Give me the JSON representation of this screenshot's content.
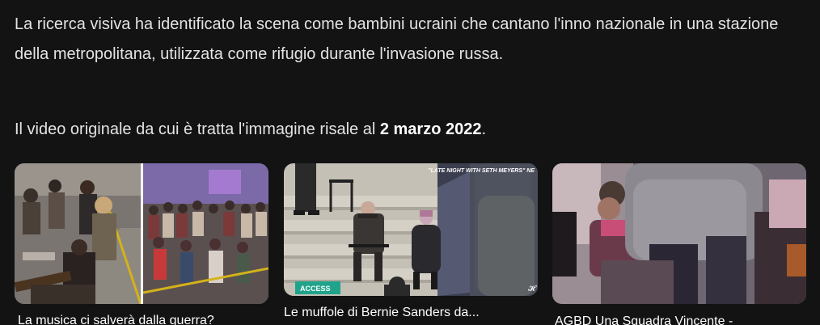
{
  "answer": {
    "paragraph1": "La ricerca visiva ha identificato la scena come bambini ucraini che cantano l'inno nazionale in una stazione della metropolitana, utilizzata come rifugio durante l'invasione russa.",
    "paragraph2_prefix": "Il video originale da cui è tratta l'immagine risale al ",
    "paragraph2_date": "2 marzo 2022",
    "paragraph2_suffix": "."
  },
  "results": [
    {
      "title": "La musica ci salverà dalla guerra?"
    },
    {
      "title": "Le muffole di Bernie Sanders da...",
      "overlay_top": "\"LATE NIGHT WITH SETH MEYERS\" NE",
      "badge": "ACCESS"
    },
    {
      "title": "AGBD Una Squadra Vincente -"
    }
  ]
}
